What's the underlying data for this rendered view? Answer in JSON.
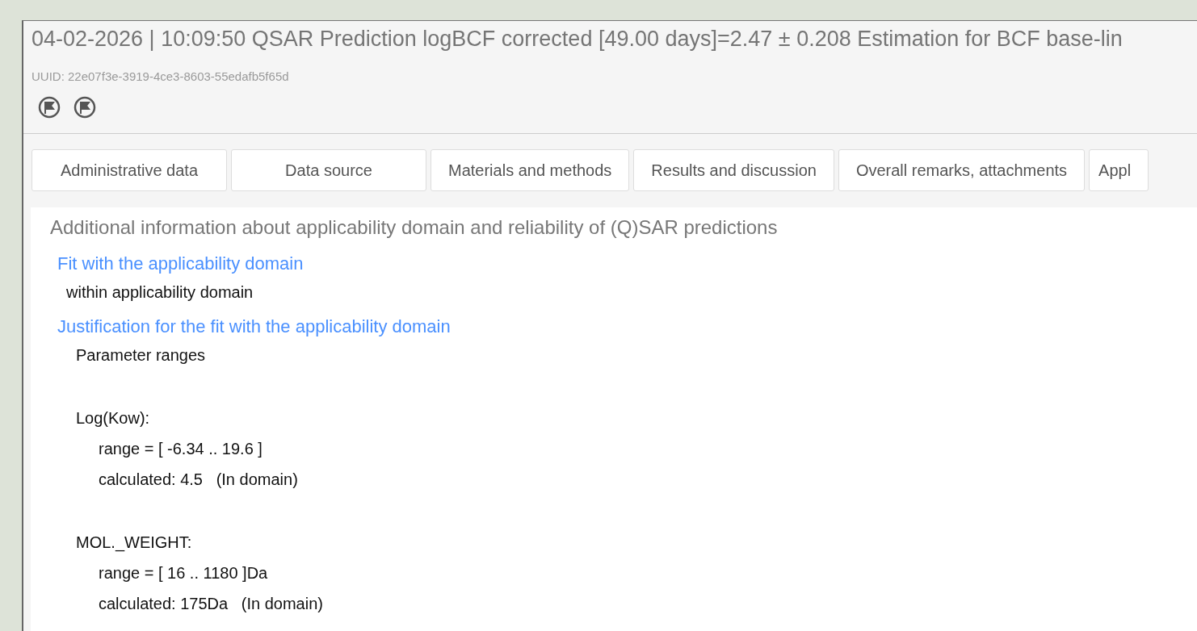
{
  "record": {
    "title": "04-02-2026 | 10:09:50 QSAR Prediction logBCF corrected [49.00 days]=2.47 ± 0.208 Estimation for BCF base-lin",
    "uuid": "UUID: 22e07f3e-3919-4ce3-8603-55edafb5f65d"
  },
  "tabs": [
    {
      "label": "Administrative data",
      "selected": false
    },
    {
      "label": "Data source",
      "selected": false
    },
    {
      "label": "Materials and methods",
      "selected": false
    },
    {
      "label": "Results and discussion",
      "selected": false
    },
    {
      "label": "Overall remarks, attachments",
      "selected": false
    },
    {
      "label": "Appl",
      "selected": false
    }
  ],
  "section": {
    "heading": "Additional information about applicability domain and reliability of (Q)SAR predictions",
    "fields": [
      {
        "label": "Fit with the applicability domain",
        "value": "within applicability domain"
      },
      {
        "label": "Justification for the fit with the applicability domain",
        "intro": "Parameter ranges",
        "parameters": [
          {
            "name": "Log(Kow):",
            "range": "range = [ -6.34 .. 19.6 ]",
            "calculated": "calculated: 4.5   (In domain)"
          },
          {
            "name": "MOL._WEIGHT:",
            "range": "range = [ 16 .. 1180 ]Da",
            "calculated": "calculated: 175Da   (In domain)"
          }
        ]
      }
    ]
  }
}
